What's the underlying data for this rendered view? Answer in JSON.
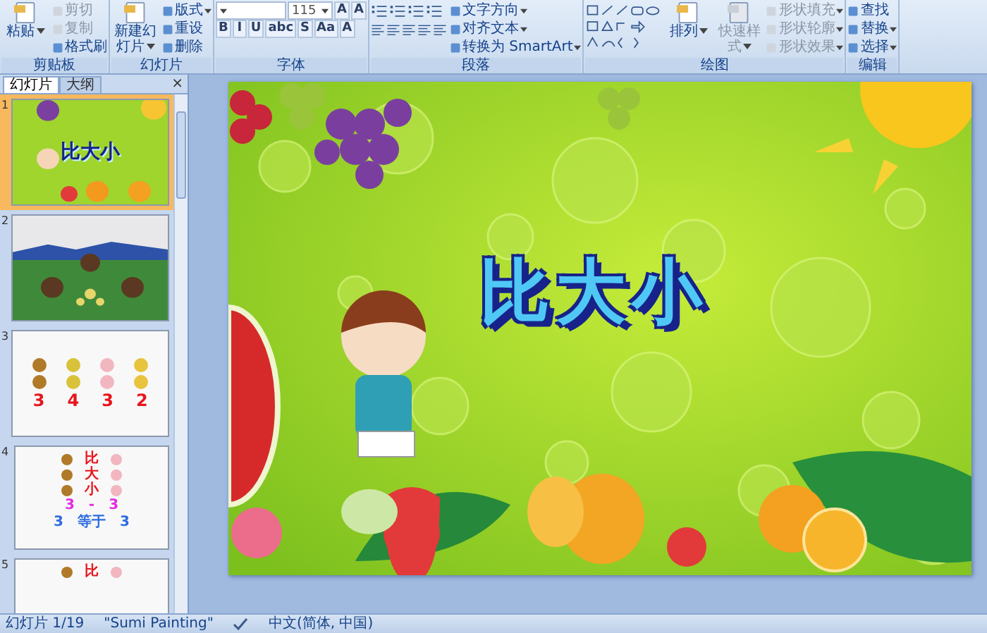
{
  "ribbon": {
    "groups": [
      {
        "label": "剪贴板",
        "columns": [
          {
            "rows": [
              {
                "items": [
                  {
                    "kind": "large",
                    "label": "粘贴",
                    "dropdown": true,
                    "disabled": false
                  }
                ]
              }
            ]
          },
          {
            "rows": [
              {
                "items": [
                  {
                    "kind": "small",
                    "label": "剪切",
                    "dropdown": false,
                    "disabled": true
                  }
                ]
              },
              {
                "items": [
                  {
                    "kind": "small",
                    "label": "复制",
                    "dropdown": false,
                    "disabled": true
                  }
                ]
              },
              {
                "items": [
                  {
                    "kind": "small",
                    "label": "格式刷",
                    "dropdown": false,
                    "disabled": false
                  }
                ]
              }
            ]
          }
        ]
      },
      {
        "label": "幻灯片",
        "columns": [
          {
            "rows": [
              {
                "items": [
                  {
                    "kind": "large",
                    "label": "新建幻灯片",
                    "dropdown": true,
                    "disabled": false
                  }
                ]
              }
            ]
          },
          {
            "rows": [
              {
                "items": [
                  {
                    "kind": "small",
                    "label": "版式",
                    "dropdown": true,
                    "disabled": false
                  }
                ]
              },
              {
                "items": [
                  {
                    "kind": "small",
                    "label": "重设",
                    "dropdown": false,
                    "disabled": false
                  }
                ]
              },
              {
                "items": [
                  {
                    "kind": "small",
                    "label": "删除",
                    "dropdown": false,
                    "disabled": false
                  }
                ]
              }
            ]
          }
        ]
      },
      {
        "label": "字体",
        "columns": [
          {
            "rows": [
              {
                "items": [
                  {
                    "kind": "font-field"
                  },
                  {
                    "kind": "size-field",
                    "value": "115"
                  },
                  {
                    "kind": "glyph",
                    "label": "A"
                  },
                  {
                    "kind": "glyph",
                    "label": "A"
                  }
                ]
              },
              {
                "items": [
                  {
                    "kind": "glyph",
                    "label": "B"
                  },
                  {
                    "kind": "glyph",
                    "label": "I"
                  },
                  {
                    "kind": "glyph",
                    "label": "U"
                  },
                  {
                    "kind": "glyph",
                    "label": "abc"
                  },
                  {
                    "kind": "glyph",
                    "label": "S"
                  },
                  {
                    "kind": "glyph",
                    "label": "Aa"
                  },
                  {
                    "kind": "glyph",
                    "label": "A"
                  }
                ]
              }
            ]
          }
        ]
      },
      {
        "label": "段落",
        "columns": [
          {
            "rows": [
              {
                "items": [
                  {
                    "kind": "lists"
                  }
                ]
              },
              {
                "items": [
                  {
                    "kind": "align"
                  }
                ]
              }
            ]
          },
          {
            "rows": [
              {
                "items": [
                  {
                    "kind": "small",
                    "label": "文字方向",
                    "dropdown": true,
                    "disabled": false
                  }
                ]
              },
              {
                "items": [
                  {
                    "kind": "small",
                    "label": "对齐文本",
                    "dropdown": true,
                    "disabled": false
                  }
                ]
              },
              {
                "items": [
                  {
                    "kind": "small",
                    "label": "转换为 SmartArt",
                    "dropdown": true,
                    "disabled": false
                  }
                ]
              }
            ]
          }
        ]
      },
      {
        "label": "绘图",
        "columns": [
          {
            "rows": [
              {
                "items": [
                  {
                    "kind": "shapes"
                  }
                ]
              }
            ]
          },
          {
            "rows": [
              {
                "items": [
                  {
                    "kind": "large",
                    "label": "排列",
                    "dropdown": true,
                    "disabled": false
                  }
                ]
              }
            ]
          },
          {
            "rows": [
              {
                "items": [
                  {
                    "kind": "large",
                    "label": "快速样式",
                    "dropdown": true,
                    "disabled": true
                  }
                ]
              }
            ]
          },
          {
            "rows": [
              {
                "items": [
                  {
                    "kind": "small",
                    "label": "形状填充",
                    "dropdown": true,
                    "disabled": true
                  }
                ]
              },
              {
                "items": [
                  {
                    "kind": "small",
                    "label": "形状轮廓",
                    "dropdown": true,
                    "disabled": true
                  }
                ]
              },
              {
                "items": [
                  {
                    "kind": "small",
                    "label": "形状效果",
                    "dropdown": true,
                    "disabled": true
                  }
                ]
              }
            ]
          }
        ]
      },
      {
        "label": "编辑",
        "columns": [
          {
            "rows": [
              {
                "items": [
                  {
                    "kind": "small",
                    "label": "查找",
                    "dropdown": false,
                    "disabled": false
                  }
                ]
              },
              {
                "items": [
                  {
                    "kind": "small",
                    "label": "替换",
                    "dropdown": true,
                    "disabled": false
                  }
                ]
              },
              {
                "items": [
                  {
                    "kind": "small",
                    "label": "选择",
                    "dropdown": true,
                    "disabled": false
                  }
                ]
              }
            ]
          }
        ]
      }
    ]
  },
  "panel": {
    "tabs": [
      {
        "label": "幻灯片",
        "selected": true
      },
      {
        "label": "大纲",
        "selected": false
      }
    ],
    "close": "×",
    "slides": [
      {
        "number": "1",
        "selected": true,
        "kind": "title",
        "title": "比大小"
      },
      {
        "number": "2",
        "selected": false,
        "kind": "painting"
      },
      {
        "number": "3",
        "selected": false,
        "kind": "counts",
        "values": [
          "3",
          "4",
          "3",
          "2"
        ]
      },
      {
        "number": "4",
        "selected": false,
        "kind": "compare",
        "words": [
          "比",
          "大",
          "小"
        ],
        "equation": [
          "3",
          "-",
          "3"
        ],
        "result": [
          "3",
          "等于",
          "3"
        ]
      },
      {
        "number": "5",
        "selected": false,
        "kind": "compare",
        "words": [
          "比"
        ]
      }
    ]
  },
  "slide": {
    "title": "比大小"
  },
  "status_bar": {
    "slide": "幻灯片 1/19",
    "theme": "\"Sumi Painting\"",
    "language": "中文(简体, 中国)"
  }
}
